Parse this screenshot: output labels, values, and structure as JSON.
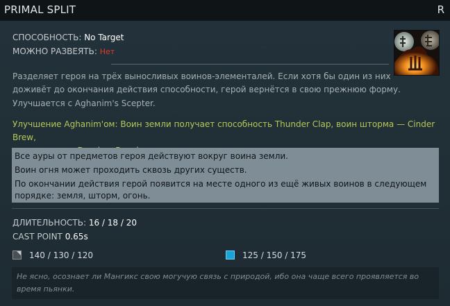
{
  "ability": {
    "name": "PRIMAL SPLIT",
    "hotkey": "R"
  },
  "stats": {
    "ability_label": "СПОСОБНОСТЬ:",
    "ability_value": "No Target",
    "dispel_label": "МОЖНО РАЗВЕЯТЬ:",
    "dispel_value": "Нет",
    "duration_label": "ДЛИТЕЛЬНОСТЬ:",
    "duration_value": "16 / 18 / 20",
    "cast_point_label": "CAST POINT",
    "cast_point_value": "0.65s"
  },
  "description": {
    "line1": "Разделяет героя на трёх выносливых воинов-элементалей. Если хотя бы один из них",
    "line2": "доживёт до окончания действия способности, герой вернётся в свою прежнюю форму.",
    "line3": "Улучшается с Aghanim's Scepter."
  },
  "scepter": {
    "line1": "Улучшение Aghanim'ом: Воин земли получает способность Thunder Clap, воин шторма — Cinder Brew,",
    "line2": "а воин огня — Drunken Brawler."
  },
  "notes": [
    "Все ауры от предметов героя действуют вокруг воина земли.",
    "Воин огня может проходить сквозь других существ.",
    "По окончании действия герой появится на месте одного из ещё живых воинов в следующем",
    "порядке: земля, шторм, огонь."
  ],
  "costs": {
    "cooldown_icon": "cooldown-icon",
    "cooldown_value": "140 / 130 / 120",
    "mana_icon": "mana-icon",
    "mana_value": "125 / 150 / 175"
  },
  "lore": {
    "line1": "Не ясно, осознает ли Мангикс свою могучую связь с природой, ибо она чаще всего проявляется во",
    "line2": "время пьянки."
  },
  "colors": {
    "negative": "#e03b2b",
    "scepter": "#b6c75a",
    "mana": "#1aa3d6",
    "notes_bg": "#7f8e96"
  }
}
